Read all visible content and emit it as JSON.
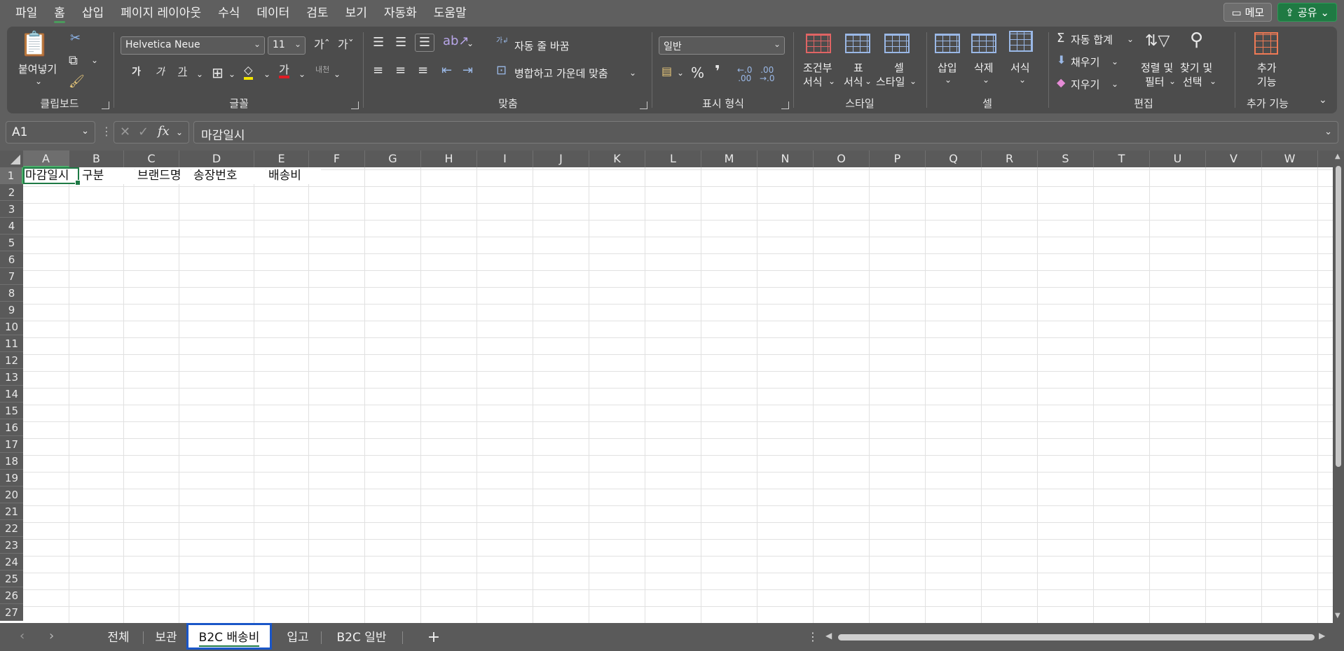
{
  "menu": {
    "tabs": [
      "파일",
      "홈",
      "삽입",
      "페이지 레이아웃",
      "수식",
      "데이터",
      "검토",
      "보기",
      "자동화",
      "도움말"
    ],
    "active_tab": "홈",
    "memo_label": "메모",
    "share_label": "공유"
  },
  "ribbon": {
    "clipboard": {
      "label": "클립보드",
      "paste_label": "붙여넣기"
    },
    "font": {
      "label": "글꼴",
      "font_name": "Helvetica Neue",
      "font_size": "11"
    },
    "alignment": {
      "label": "맞춤",
      "wrap_text": "자동 줄 바꿈",
      "merge_center": "병합하고 가운데 맞춤"
    },
    "number": {
      "label": "표시 형식",
      "format": "일반",
      "percent": "%",
      "comma": "❜"
    },
    "styles": {
      "label": "스타일",
      "conditional_line1": "조건부",
      "conditional_line2": "서식",
      "table_line1": "표",
      "table_line2": "서식",
      "cell_line1": "셀",
      "cell_line2": "스타일"
    },
    "cells": {
      "label": "셀",
      "insert": "삽입",
      "delete": "삭제",
      "format": "서식"
    },
    "editing": {
      "label": "편집",
      "autosum": "자동 합계",
      "fill": "채우기",
      "clear": "지우기",
      "sort_line1": "정렬 및",
      "sort_line2": "필터",
      "find_line1": "찾기 및",
      "find_line2": "선택"
    },
    "addins": {
      "label": "추가 기능",
      "button_line1": "추가",
      "button_line2": "기능"
    }
  },
  "formula_bar": {
    "name_box": "A1",
    "fx": "fx",
    "content": "마감일시"
  },
  "columns": [
    "A",
    "B",
    "C",
    "D",
    "E",
    "F",
    "G",
    "H",
    "I",
    "J",
    "K",
    "L",
    "M",
    "N",
    "O",
    "P",
    "Q",
    "R",
    "S",
    "T",
    "U",
    "V",
    "W"
  ],
  "rows": [
    "1",
    "2",
    "3",
    "4",
    "5",
    "6",
    "7",
    "8",
    "9",
    "10",
    "11",
    "12",
    "13",
    "14",
    "15",
    "16",
    "17",
    "18",
    "19",
    "20",
    "21",
    "22",
    "23",
    "24",
    "25",
    "26",
    "27"
  ],
  "cells": {
    "A1": "마감일시",
    "B1": "구분",
    "C1": "브랜드명",
    "D1": "송장번호",
    "E1": "배송비"
  },
  "selected_cell": "A1",
  "sheets": [
    "전체",
    "보관",
    "B2C 배송비",
    "입고",
    "B2C 일반"
  ],
  "active_sheet": "B2C 배송비",
  "add_sheet": "+",
  "colors": {
    "accent_green": "#1e7a45",
    "active_tab_border": "#1a56c8",
    "share_green": "#1f7a43"
  }
}
